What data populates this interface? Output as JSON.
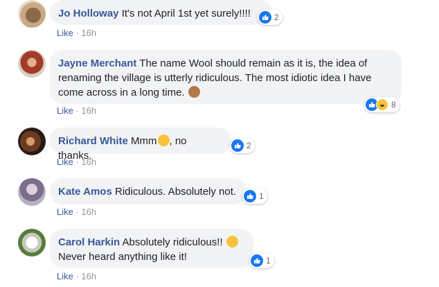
{
  "comments": [
    {
      "author": "Jo Holloway",
      "text": " It's not April 1st yet surely!!!!",
      "like_label": "Like",
      "age": "16h",
      "reaction_count": "2",
      "reactions": [
        "like"
      ]
    },
    {
      "author": "Jayne Merchant",
      "text": " The name Wool should remain as it is, the idea of renaming the village is utterly ridiculous. The most idiotic idea I have come across in a long time.",
      "emoji": "see-no-evil-monkey",
      "like_label": "Like",
      "age": "16h",
      "reaction_count": "8",
      "reactions": [
        "like",
        "haha"
      ]
    },
    {
      "author": "Richard White",
      "text_before": " Mmm",
      "emoji": "thinking-face",
      "text_after": ", no thanks.",
      "like_label": "Like",
      "age": "16h",
      "reaction_count": "2",
      "reactions": [
        "like"
      ]
    },
    {
      "author": "Kate Amos",
      "text": " Ridiculous. Absolutely not.",
      "like_label": "Like",
      "age": "16h",
      "reaction_count": "1",
      "reactions": [
        "like"
      ]
    },
    {
      "author": "Carol Harkin",
      "text_line1": " Absolutely ridiculous!! ",
      "emoji": "rolling-on-floor-laughing",
      "text_line2": "Never heard anything like it!",
      "like_label": "Like",
      "age": "16h",
      "reaction_count": "1",
      "reactions": [
        "like"
      ]
    }
  ],
  "colors": {
    "author": "#385898",
    "bubble": "#f2f3f5",
    "meta": "#90949c",
    "like_reaction": "#1877f2",
    "haha_reaction": "#f7c33b"
  }
}
